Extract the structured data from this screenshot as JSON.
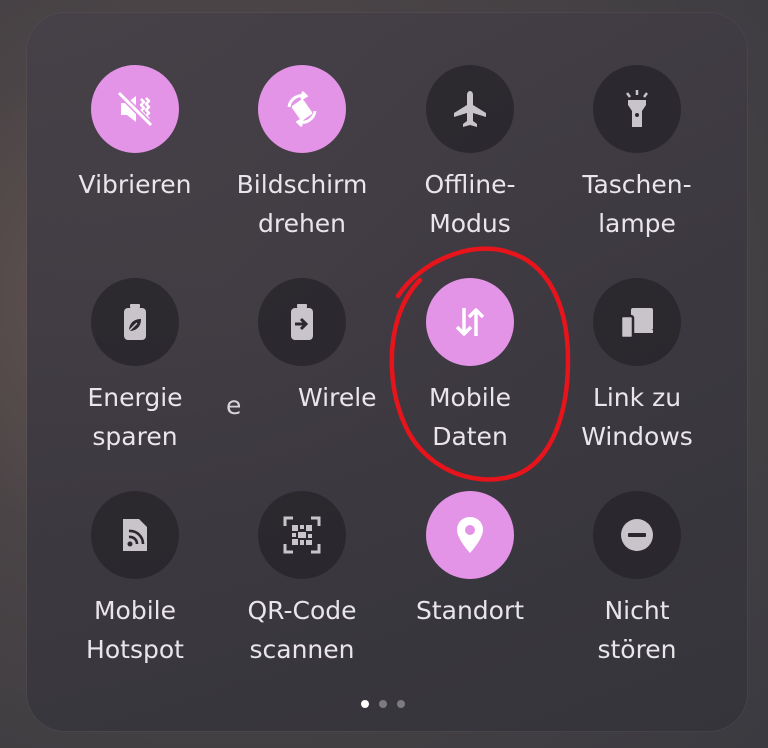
{
  "colors": {
    "active_tile": "#e394e6",
    "inactive_tile": "#2a282e",
    "active_glyph": "#ffffff",
    "inactive_glyph": "#c8c4c9",
    "annotation": "#e8141c"
  },
  "tiles": [
    {
      "label": "Vibrieren",
      "icon": "vibrate-off-icon",
      "active": true
    },
    {
      "label": "Bildschirm\ndrehen",
      "icon": "screen-rotate-icon",
      "active": true
    },
    {
      "label": "Offline-\nModus",
      "icon": "airplane-icon",
      "active": false
    },
    {
      "label": "Taschen-\nlampe",
      "icon": "flashlight-icon",
      "active": false
    },
    {
      "label": "Energie\nsparen",
      "icon": "battery-leaf-icon",
      "active": false
    },
    {
      "label": "Wirele",
      "icon": "battery-share-icon",
      "active": false
    },
    {
      "label": "Mobile\nDaten",
      "icon": "mobile-data-icon",
      "active": true
    },
    {
      "label": "Link zu\nWindows",
      "icon": "link-to-windows-icon",
      "active": false
    },
    {
      "label": "Mobile\nHotspot",
      "icon": "hotspot-icon",
      "active": false
    },
    {
      "label": "QR-Code\nscannen",
      "icon": "qr-code-icon",
      "active": false
    },
    {
      "label": "Standort",
      "icon": "location-pin-icon",
      "active": true
    },
    {
      "label": "Nicht\nstören",
      "icon": "do-not-disturb-icon",
      "active": false
    }
  ],
  "ghost_text": "e",
  "pagination": {
    "pages": 3,
    "current": 1
  }
}
